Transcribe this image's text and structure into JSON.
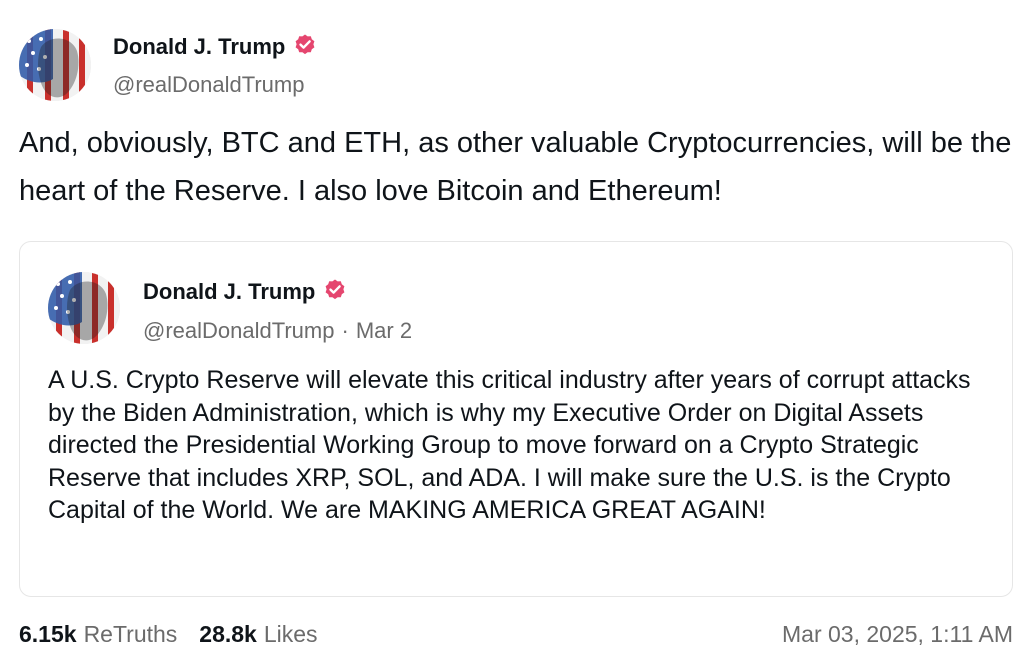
{
  "post": {
    "author": {
      "display_name": "Donald J. Trump",
      "handle": "@realDonaldTrump",
      "verified": true,
      "avatar": "profile-picture"
    },
    "text": "And, obviously, BTC and ETH, as other valuable Cryptocurrencies, will be the heart of the Reserve. I also love Bitcoin and Ethereum!",
    "quote": {
      "author": {
        "display_name": "Donald J. Trump",
        "handle": "@realDonaldTrump",
        "verified": true,
        "avatar": "profile-picture"
      },
      "separator": "·",
      "date": "Mar 2",
      "text": "A U.S. Crypto Reserve will elevate this critical industry after years of corrupt attacks by the Biden Administration, which is why my Executive Order on Digital Assets directed the Presidential Working Group to move forward on a Crypto Strategic Reserve that includes XRP, SOL, and ADA. I will make sure the U.S. is the Crypto Capital of the World. We are MAKING AMERICA GREAT AGAIN!"
    },
    "stats": {
      "retruths_count": "6.15k",
      "retruths_label": "ReTruths",
      "likes_count": "28.8k",
      "likes_label": "Likes"
    },
    "timestamp": "Mar 03, 2025, 1:11 AM"
  },
  "colors": {
    "text": "#0f1419",
    "secondary_text": "#6b6b6b",
    "verified_badge": "#e5466f",
    "card_border": "#e6e6e6"
  }
}
